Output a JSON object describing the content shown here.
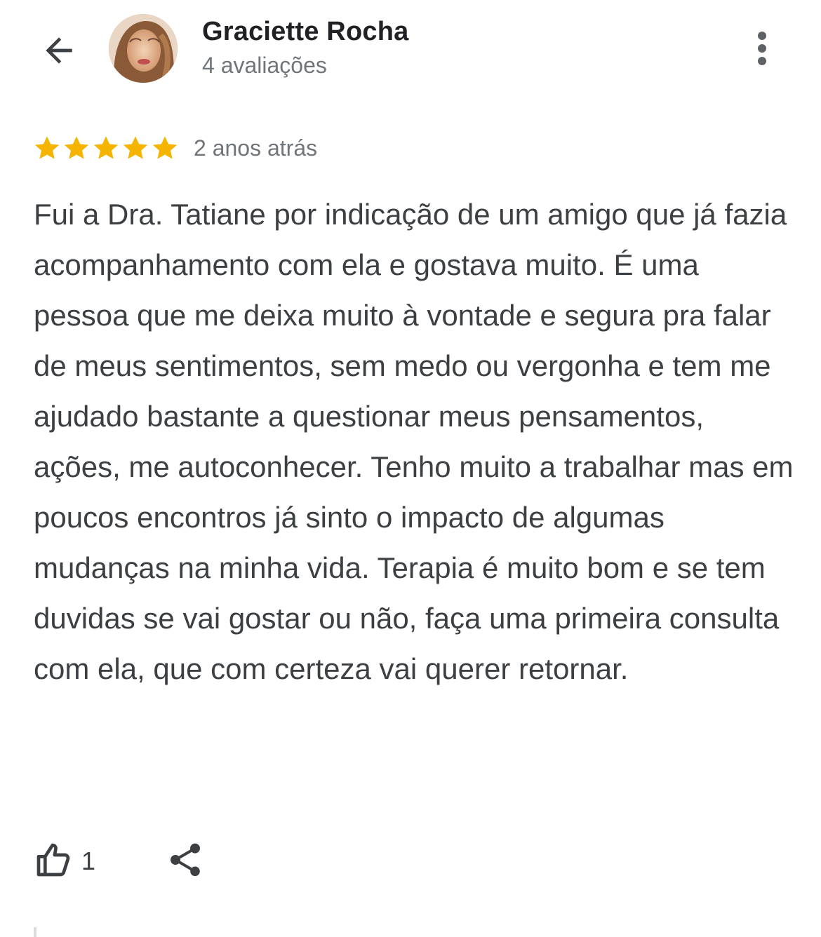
{
  "header": {
    "back_icon": "arrow-back-icon",
    "author_name": "Graciette Rocha",
    "review_count": "4 avaliações",
    "more_icon": "more-vert-icon"
  },
  "review": {
    "rating": 5,
    "rating_max": 5,
    "star_color": "#F4B400",
    "star_icon": "star-icon",
    "time_ago": "2 anos atrás",
    "text": "Fui a Dra. Tatiane por indicação de um amigo que já fazia acompanhamento com ela e gostava muito. É uma pessoa que me deixa muito à vontade e segura pra falar de meus sentimentos, sem medo ou vergonha e tem me ajudado bastante a questionar meus pensamentos, ações, me autoconhecer. Tenho muito a trabalhar mas em poucos encontros já sinto o impacto de algumas mudanças na minha vida. Terapia é muito bom e se tem duvidas se vai gostar ou não, faça uma primeira consulta com ela, que com certeza vai querer retornar."
  },
  "actions": {
    "like_icon": "thumb-up-icon",
    "like_count": "1",
    "share_icon": "share-icon"
  }
}
